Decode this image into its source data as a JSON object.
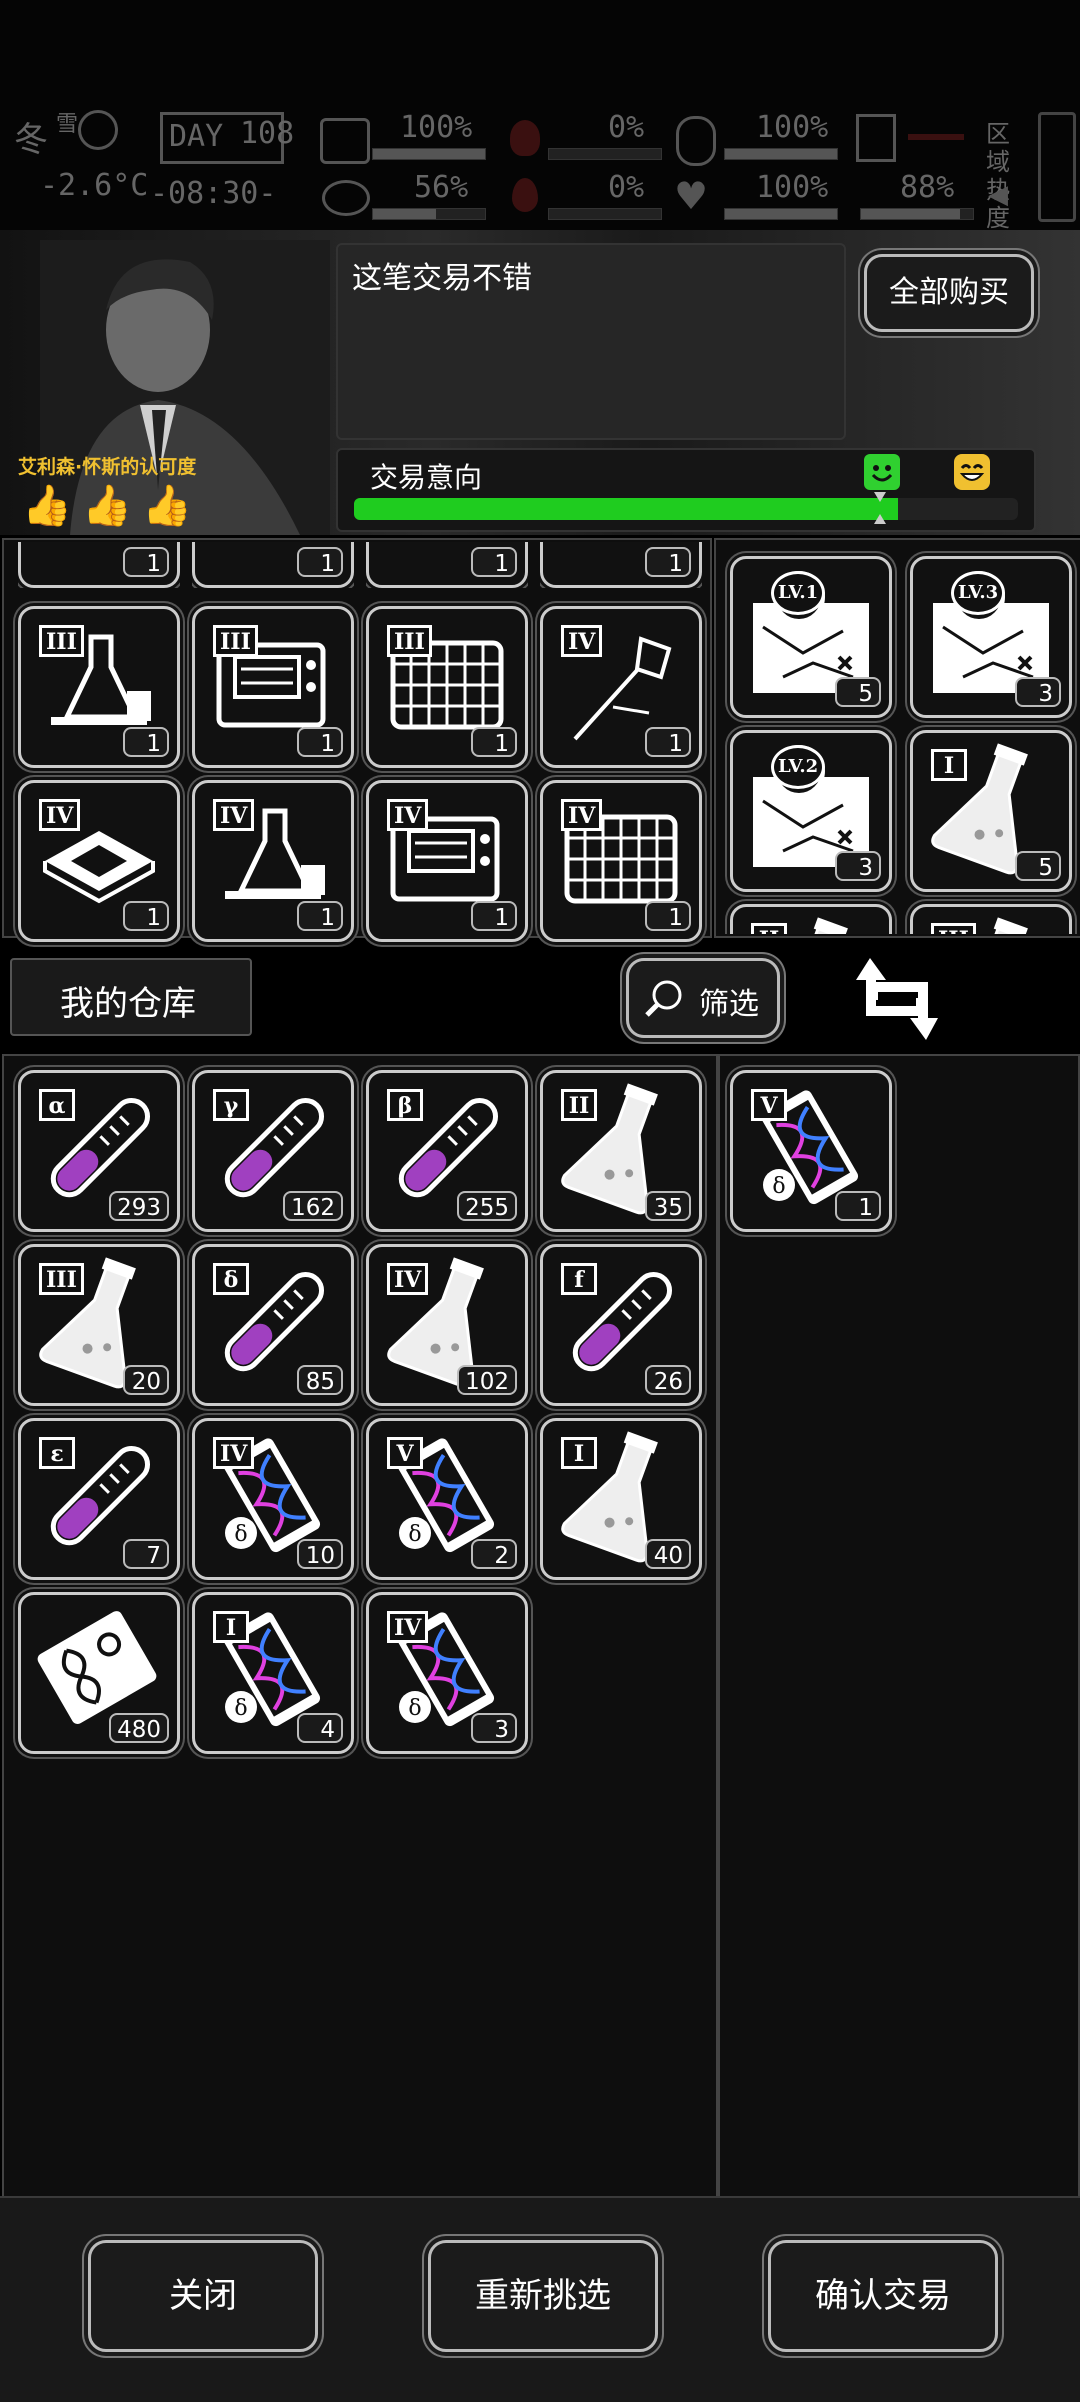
{
  "status": {
    "season": "冬",
    "season_sub": "雪",
    "day_label": "DAY",
    "day": "108",
    "temperature": "-2.6°C",
    "time": "-08:30-",
    "meters": [
      {
        "name": "health",
        "value": "100%"
      },
      {
        "name": "hunger",
        "value": "0%"
      },
      {
        "name": "mood",
        "value": "100%"
      },
      {
        "name": "sanity",
        "value": "56%"
      },
      {
        "name": "thirst",
        "value": "0%"
      },
      {
        "name": "heart",
        "value": "100%"
      },
      {
        "name": "stamina",
        "value": "88%"
      }
    ],
    "zone_label": "区域热度"
  },
  "trader": {
    "name_line": "艾利森·怀斯的认可度",
    "thumbs_count": 3,
    "speech": "这笔交易不错",
    "buy_all": "全部购买",
    "intent_label": "交易意向",
    "intent_level": 0.82
  },
  "trader_items": {
    "left_top_row_counts": [
      "1",
      "1",
      "1",
      "1"
    ],
    "left_grid": [
      {
        "tier": "III",
        "icon": "chemistry-set-icon",
        "count": "1"
      },
      {
        "tier": "III",
        "icon": "machine-icon",
        "count": "1"
      },
      {
        "tier": "III",
        "icon": "grid-panel-icon",
        "count": "1"
      },
      {
        "tier": "IV",
        "icon": "drill-tool-icon",
        "count": "1"
      },
      {
        "tier": "IV",
        "icon": "chip-icon",
        "count": "1"
      },
      {
        "tier": "IV",
        "icon": "chemistry-set-icon",
        "count": "1"
      },
      {
        "tier": "IV",
        "icon": "machine-icon",
        "count": "1"
      },
      {
        "tier": "IV",
        "icon": "grid-panel-icon",
        "count": "1"
      }
    ],
    "right_grid": [
      {
        "tier": "LV.1",
        "icon": "map-icon",
        "count": "5"
      },
      {
        "tier": "LV.3",
        "icon": "map-icon",
        "count": "3"
      },
      {
        "tier": "LV.2",
        "icon": "map-icon",
        "count": "3"
      },
      {
        "tier": "I",
        "icon": "flask-icon",
        "count": "5"
      },
      {
        "tier": "II",
        "icon": "flask-icon",
        "count": ""
      },
      {
        "tier": "III",
        "icon": "flask-icon",
        "count": ""
      }
    ]
  },
  "warehouse": {
    "title": "我的仓库",
    "filter": "筛选",
    "items": [
      {
        "tier": "α",
        "icon": "test-tube-icon",
        "count": "293"
      },
      {
        "tier": "γ",
        "icon": "test-tube-icon",
        "count": "162"
      },
      {
        "tier": "β",
        "icon": "test-tube-icon",
        "count": "255"
      },
      {
        "tier": "II",
        "icon": "flask-icon",
        "count": "35"
      },
      {
        "tier": "III",
        "icon": "flask-icon",
        "count": "20"
      },
      {
        "tier": "δ",
        "icon": "test-tube-icon",
        "count": "85"
      },
      {
        "tier": "IV",
        "icon": "flask-icon",
        "count": "102"
      },
      {
        "tier": "f",
        "icon": "test-tube-icon",
        "count": "26"
      },
      {
        "tier": "ε",
        "icon": "test-tube-icon",
        "count": "7"
      },
      {
        "tier": "IV",
        "icon": "dna-capsule-icon",
        "count": "10"
      },
      {
        "tier": "V",
        "icon": "dna-capsule-icon",
        "count": "2"
      },
      {
        "tier": "I",
        "icon": "flask-icon",
        "count": "40"
      },
      {
        "tier": "",
        "icon": "dna-card-icon",
        "count": "480"
      },
      {
        "tier": "I",
        "icon": "dna-capsule-icon",
        "count": "4"
      },
      {
        "tier": "IV",
        "icon": "dna-capsule-icon",
        "count": "3"
      }
    ],
    "offer_items": [
      {
        "tier": "V",
        "icon": "dna-capsule-icon",
        "count": "1"
      }
    ]
  },
  "footer": {
    "close": "关闭",
    "reselect": "重新挑选",
    "confirm": "确认交易"
  },
  "colors": {
    "intent_bar": "#1fcc1f",
    "purple_liquid": "#a040c0",
    "gold": "#f0c030"
  }
}
